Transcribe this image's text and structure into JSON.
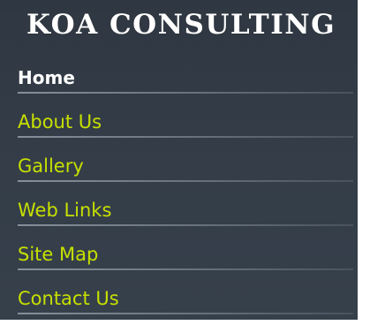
{
  "brand": {
    "title": "KOA CONSULTING"
  },
  "colors": {
    "background": "#333c47",
    "link": "#c6e000",
    "active_link": "#ffffff",
    "divider": "#7a8590"
  },
  "nav": {
    "items": [
      {
        "label": "Home",
        "active": true
      },
      {
        "label": "About Us",
        "active": false
      },
      {
        "label": "Gallery",
        "active": false
      },
      {
        "label": "Web Links",
        "active": false
      },
      {
        "label": "Site Map",
        "active": false
      },
      {
        "label": "Contact Us",
        "active": false
      }
    ]
  }
}
